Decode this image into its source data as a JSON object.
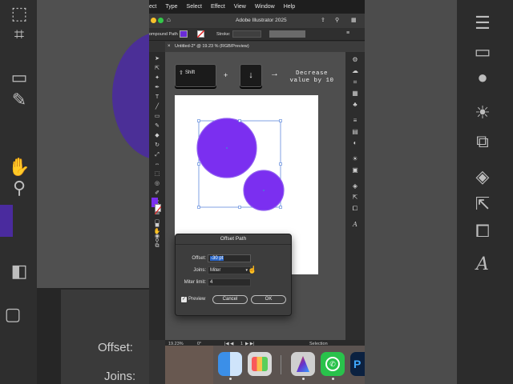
{
  "menubar": {
    "items": [
      "ect",
      "Type",
      "Select",
      "Effect",
      "View",
      "Window",
      "Help"
    ]
  },
  "window": {
    "title": "Adobe Illustrator 2025",
    "doc_tab": "Untitled-2* @ 19.23 % (RGB/Preview)"
  },
  "control_bar": {
    "object_type": "ompound Path",
    "stroke_label": "Stroke:",
    "fill_color": "#6a2bd6"
  },
  "key_overlay": {
    "key1": "Shift",
    "plus": "+",
    "key2": "↓",
    "arrow": "→",
    "text_line1": "Decrease",
    "text_line2": "value by 10"
  },
  "offset_dialog": {
    "title": "Offset Path",
    "offset_label": "Offset:",
    "offset_value": "-30 pt",
    "joins_label": "Joins:",
    "joins_value": "Miter",
    "miter_label": "Miter limit:",
    "miter_value": "4",
    "preview_label": "Preview",
    "preview_checked": true,
    "cancel_label": "Cancel",
    "ok_label": "OK"
  },
  "status_bar": {
    "zoom": "19.23%",
    "rotation": "0°",
    "artboard": "1",
    "tool": "Selection"
  },
  "background": {
    "offset_label": "Offset:",
    "joins_label": "Joins:"
  },
  "colors": {
    "circle_fill": "#7b2ff0",
    "selection_blue": "#4a7bd8"
  }
}
